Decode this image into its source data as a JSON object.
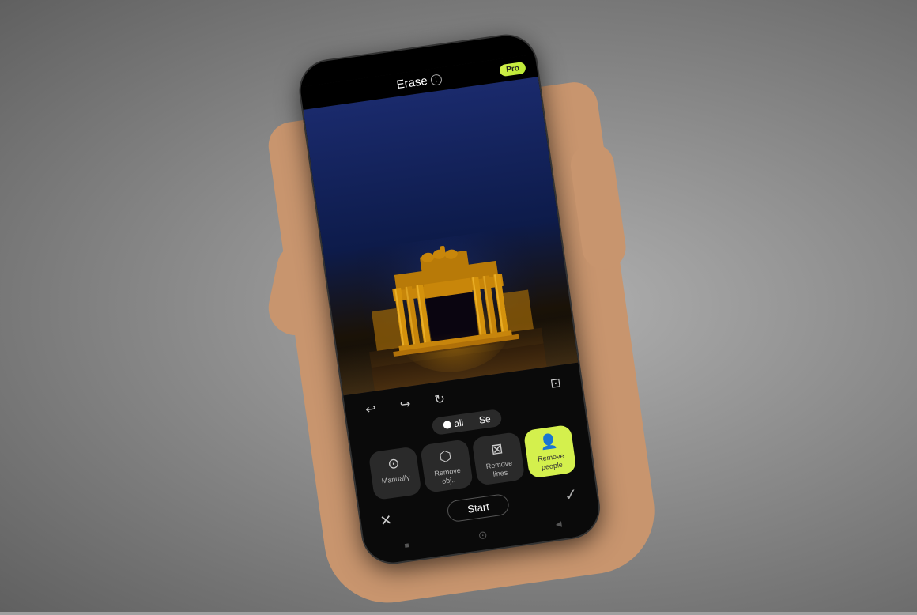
{
  "background": {
    "color": "#909090"
  },
  "phone": {
    "header": {
      "title": "Erase",
      "info_icon": "i",
      "pro_label": "Pro"
    },
    "toolbar": {
      "undo_icon": "↩",
      "redo_icon": "↪",
      "refresh_icon": "↻",
      "compare_icon": "⊡"
    },
    "select_row": {
      "option1": "all",
      "option2": "Se",
      "radio_symbol": "○"
    },
    "action_cards": [
      {
        "id": "manually",
        "icon": "⊙",
        "label": "Manually",
        "selected": false
      },
      {
        "id": "remove-obj",
        "icon": "⬡",
        "label": "Remove obj..",
        "selected": false
      },
      {
        "id": "remove-lines",
        "icon": "⊠",
        "label": "Remove lines",
        "selected": false
      },
      {
        "id": "remove-people",
        "icon": "👤",
        "label": "Remove people",
        "selected": true
      }
    ],
    "bottom_bar": {
      "close_icon": "✕",
      "start_label": "Start",
      "check_icon": "✓"
    },
    "nav_row": {
      "square_icon": "■",
      "circle_icon": "⊙",
      "back_icon": "◀"
    }
  }
}
